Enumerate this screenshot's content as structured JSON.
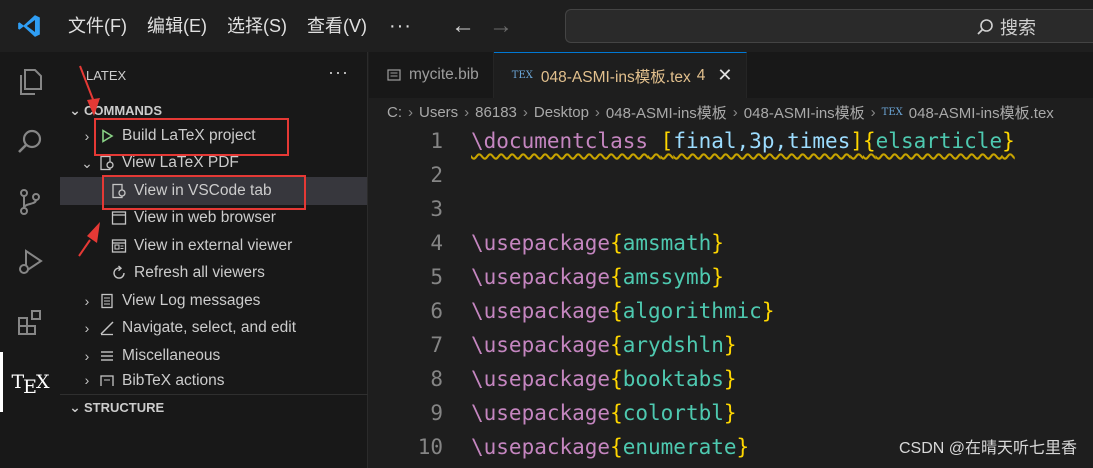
{
  "titlebar": {
    "menus": [
      "文件(F)",
      "编辑(E)",
      "选择(S)",
      "查看(V)"
    ],
    "more": "···",
    "search_label": "搜索"
  },
  "activitybar": {
    "items": [
      "explorer-icon",
      "search-icon",
      "source-control-icon",
      "run-debug-icon",
      "extensions-icon",
      "tex-icon"
    ],
    "tex_label": "TEX"
  },
  "sidebar": {
    "title": "LATEX",
    "more": "···",
    "commands_label": "COMMANDS",
    "items": [
      {
        "label": "Build LaTeX project",
        "icon": "play-icon"
      },
      {
        "label": "View LaTeX PDF",
        "icon": "pdf-view-icon"
      },
      {
        "label": "View in VSCode tab",
        "icon": "pdf-view-icon"
      },
      {
        "label": "View in web browser",
        "icon": "browser-icon"
      },
      {
        "label": "View in external viewer",
        "icon": "external-viewer-icon"
      },
      {
        "label": "Refresh all viewers",
        "icon": "refresh-icon"
      },
      {
        "label": "View Log messages",
        "icon": "log-icon"
      },
      {
        "label": "Navigate, select, and edit",
        "icon": "edit-icon"
      },
      {
        "label": "Miscellaneous",
        "icon": "list-icon"
      },
      {
        "label": "BibTeX actions",
        "icon": "bibtex-icon"
      }
    ],
    "structure_label": "STRUCTURE"
  },
  "editor": {
    "tabs": [
      {
        "label": "mycite.bib"
      },
      {
        "label": "048-ASMI-ins模板.tex",
        "count": "4",
        "close": "✕"
      }
    ],
    "breadcrumb": [
      "C:",
      "Users",
      "86183",
      "Desktop",
      "048-ASMI-ins模板",
      "048-ASMI-ins模板",
      "048-ASMI-ins模板.tex"
    ],
    "lines": [
      {
        "n": "1",
        "cmd": "\\documentclass",
        "opt": "final,3p,times",
        "arg": "elsarticle"
      },
      {
        "n": "2"
      },
      {
        "n": "3"
      },
      {
        "n": "4",
        "cmd": "\\usepackage",
        "arg": "amsmath"
      },
      {
        "n": "5",
        "cmd": "\\usepackage",
        "arg": "amssymb"
      },
      {
        "n": "6",
        "cmd": "\\usepackage",
        "arg": "algorithmic"
      },
      {
        "n": "7",
        "cmd": "\\usepackage",
        "arg": "arydshln"
      },
      {
        "n": "8",
        "cmd": "\\usepackage",
        "arg": "booktabs"
      },
      {
        "n": "9",
        "cmd": "\\usepackage",
        "arg": "colortbl"
      },
      {
        "n": "10",
        "cmd": "\\usepackage",
        "arg": "enumerate"
      }
    ]
  },
  "watermark": "CSDN @在晴天听七里香",
  "colors": {
    "keyword": "#c586c0",
    "brace": "#ffd700",
    "argument": "#4ec9b0",
    "annotation": "#e53935",
    "vscode_blue": "#2f9ef4"
  }
}
